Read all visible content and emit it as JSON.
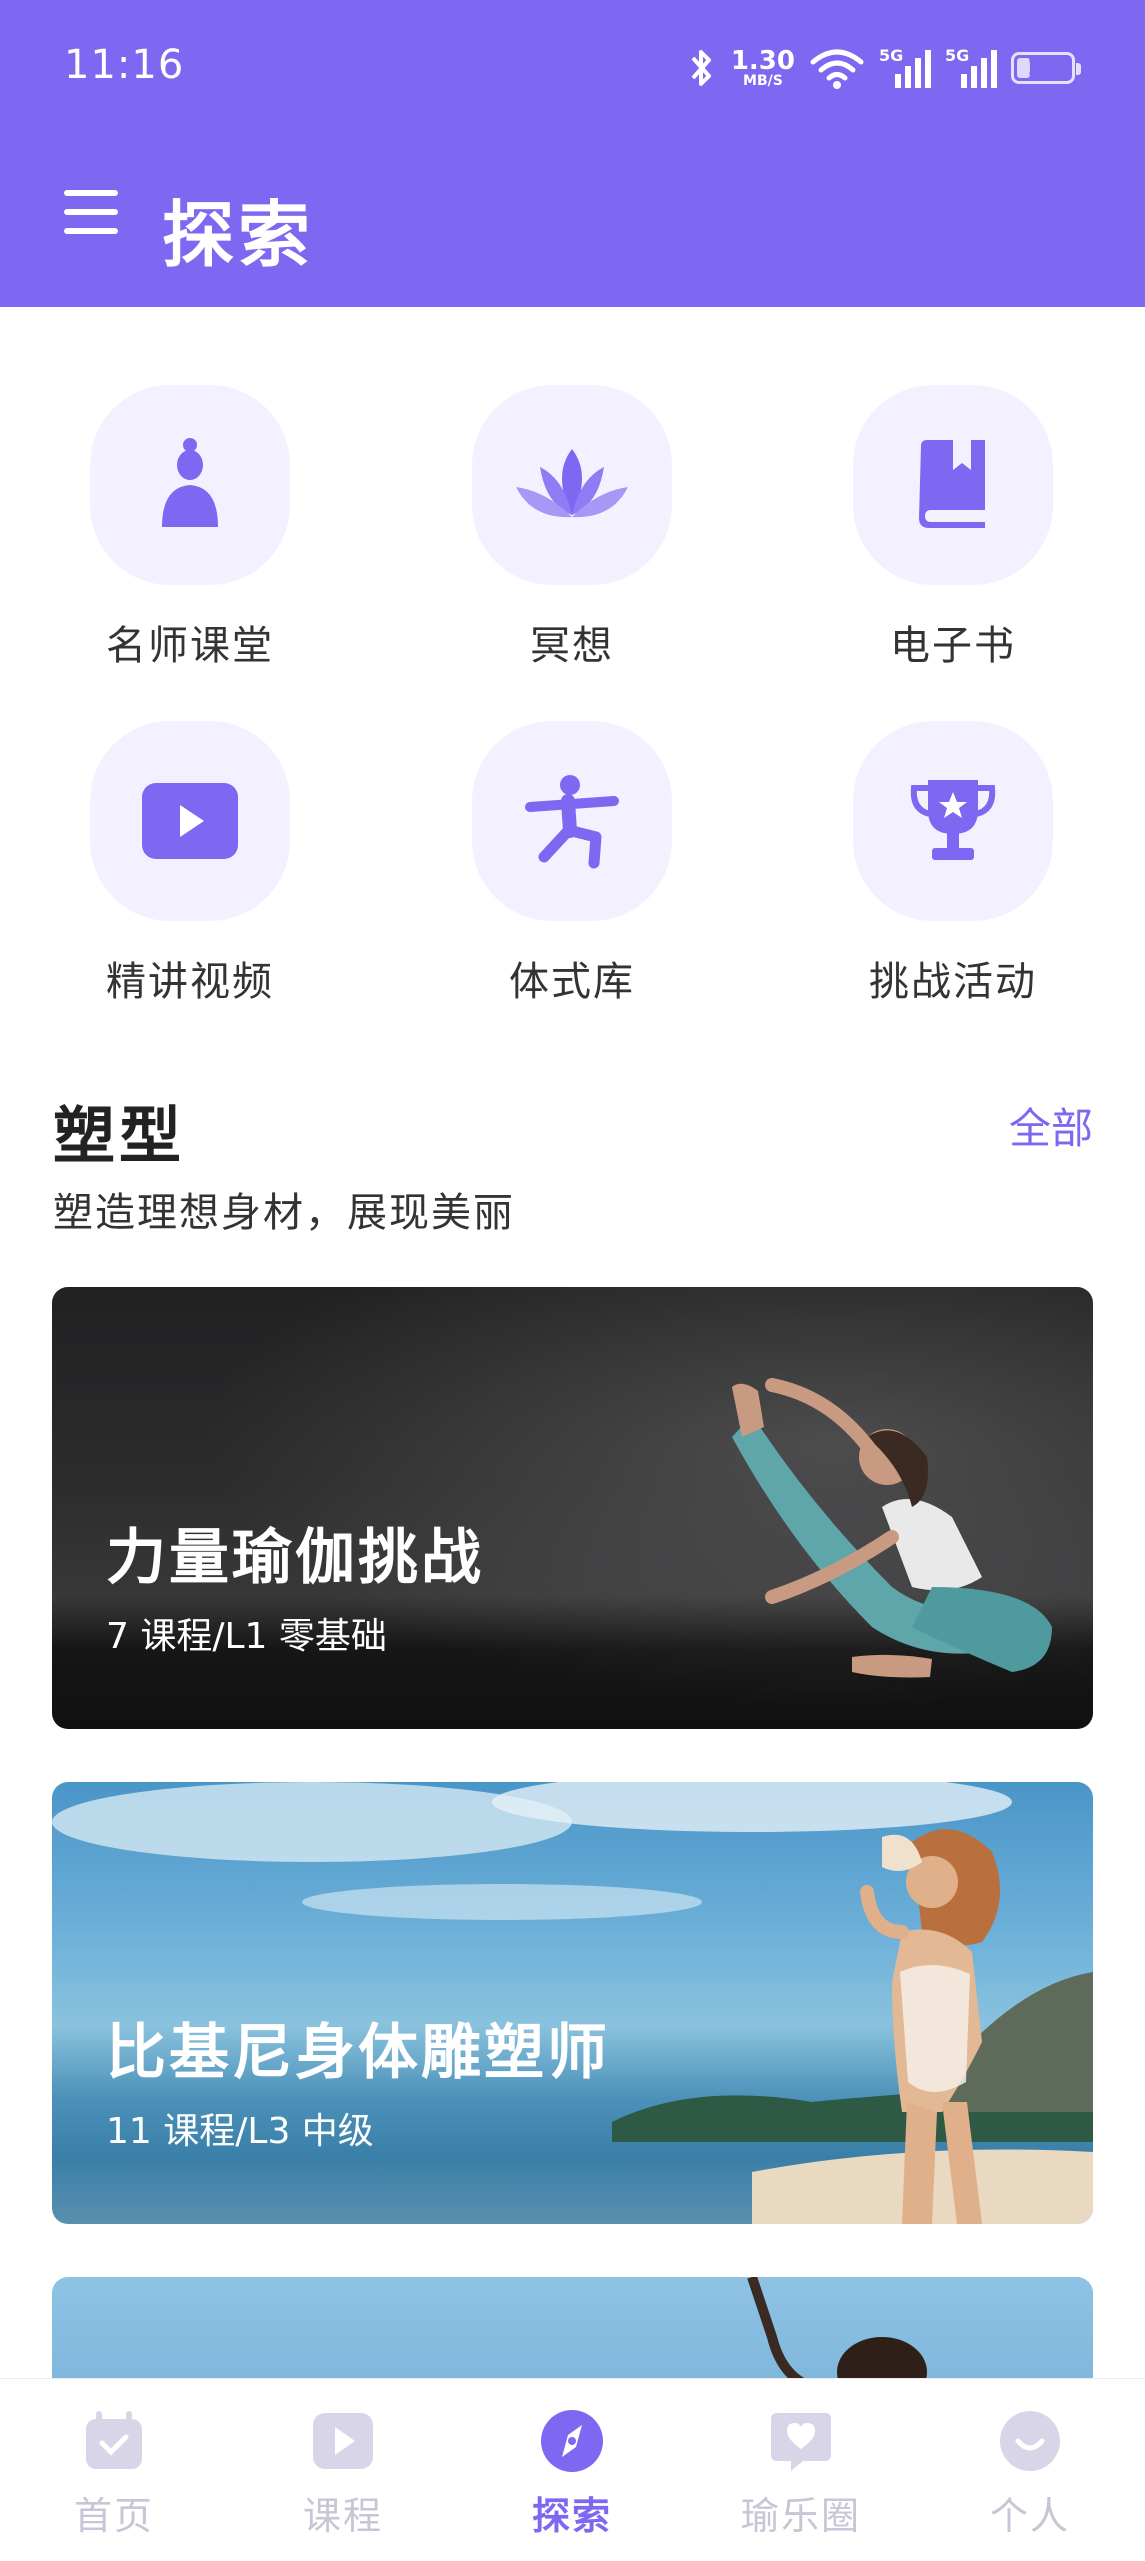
{
  "status_bar": {
    "time": "11:16",
    "net_speed_value": "1.30",
    "net_speed_unit": "MB/S",
    "signal_label": "5G",
    "battery": "22"
  },
  "header": {
    "title": "探索"
  },
  "quick_links": [
    {
      "label": "名师课堂",
      "icon": "teacher-icon"
    },
    {
      "label": "冥想",
      "icon": "lotus-icon"
    },
    {
      "label": "电子书",
      "icon": "book-icon"
    },
    {
      "label": "精讲视频",
      "icon": "video-play-icon"
    },
    {
      "label": "体式库",
      "icon": "yoga-pose-icon"
    },
    {
      "label": "挑战活动",
      "icon": "trophy-icon"
    }
  ],
  "section": {
    "title": "塑型",
    "subtitle": "塑造理想身材，展现美丽",
    "all_label": "全部"
  },
  "cards": [
    {
      "title": "力量瑜伽挑战",
      "meta": "7 课程/L1 零基础"
    },
    {
      "title": "比基尼身体雕塑师",
      "meta": "11 课程/L3 中级"
    },
    {
      "title": "",
      "meta": ""
    }
  ],
  "bottom_nav": [
    {
      "label": "首页",
      "icon": "calendar-icon"
    },
    {
      "label": "课程",
      "icon": "play-icon"
    },
    {
      "label": "探索",
      "icon": "compass-icon",
      "active": true
    },
    {
      "label": "瑜乐圈",
      "icon": "heart-chat-icon"
    },
    {
      "label": "个人",
      "icon": "face-icon"
    }
  ],
  "colors": {
    "accent": "#7e67f1",
    "tile_bg": "#f3f1ff",
    "inactive_nav": "#c9c4d6"
  }
}
